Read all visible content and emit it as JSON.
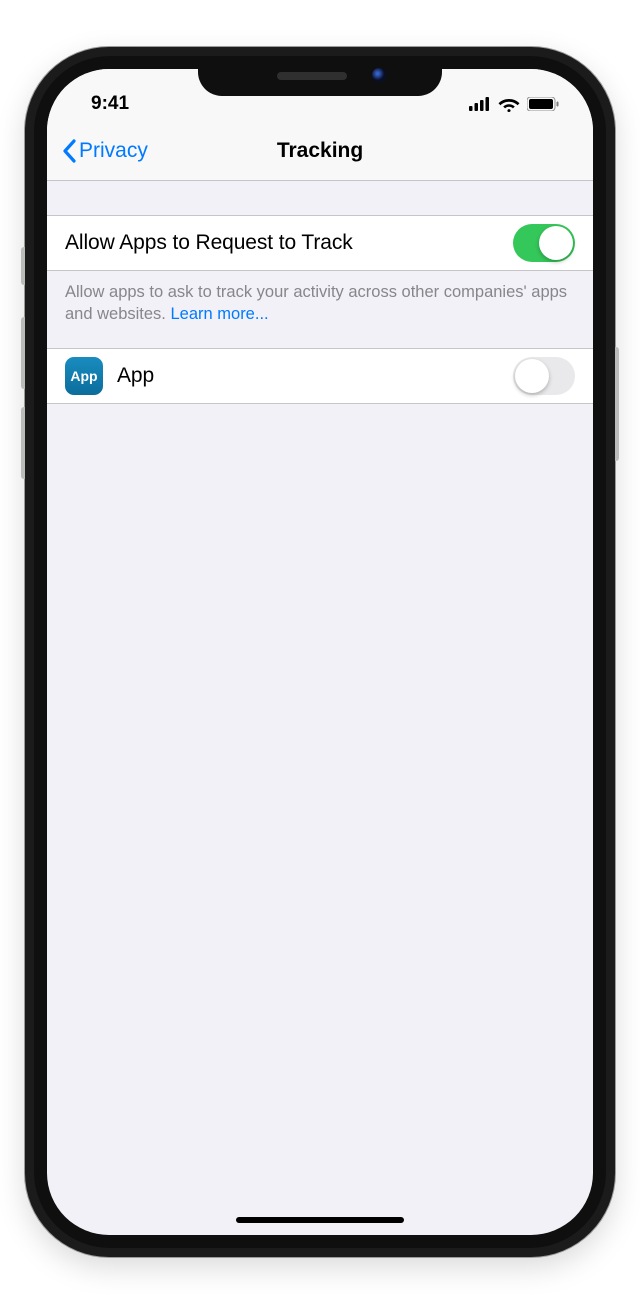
{
  "status": {
    "time": "9:41"
  },
  "nav": {
    "back_label": "Privacy",
    "title": "Tracking"
  },
  "tracking": {
    "master": {
      "label": "Allow Apps to Request to Track",
      "on": true
    },
    "footnote": "Allow apps to ask to track your activity across other companies' apps and websites. ",
    "learn_more": "Learn more...",
    "apps": [
      {
        "name": "App",
        "icon_text": "App",
        "on": false
      }
    ]
  }
}
